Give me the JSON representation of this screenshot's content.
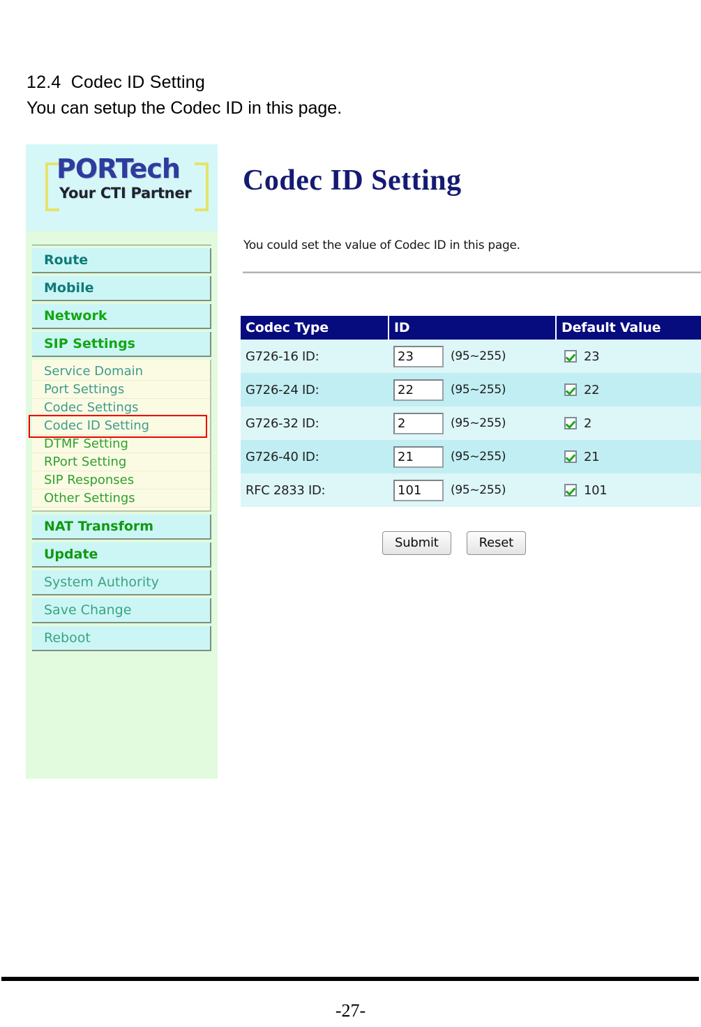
{
  "document": {
    "section_number": "12.4",
    "section_title": "12.4  Codec ID Setting",
    "section_intro": "You can setup the Codec ID in this page.",
    "page_number": "-27-"
  },
  "colors": {
    "header_navy": "#060b7d",
    "title_navy": "#151b72",
    "row_light": "#ddf6f8",
    "row_dark": "#c1eef3",
    "sidebar_green": "#e2fade",
    "logo_cyan": "#d6f7f7",
    "menu_cyan": "#ccf6f6",
    "submenu_cream": "#fbfbe4",
    "highlight_red": "#ee0000",
    "check_green": "#1ea81e"
  },
  "sidebar": {
    "logo": {
      "brand": "PORTech",
      "tagline": "Your CTI Partner"
    },
    "main_items": [
      {
        "label": "Route",
        "style": "teal-bold"
      },
      {
        "label": "Mobile",
        "style": "teal-bold"
      },
      {
        "label": "Network",
        "style": "green-bold"
      },
      {
        "label": "SIP Settings",
        "style": "green-bold"
      }
    ],
    "sip_submenu": [
      {
        "label": "Service Domain",
        "selected": false
      },
      {
        "label": "Port Settings",
        "selected": false
      },
      {
        "label": "Codec Settings",
        "selected": false
      },
      {
        "label": "Codec ID Setting",
        "selected": true
      },
      {
        "label": "DTMF Setting",
        "selected": false
      },
      {
        "label": "RPort Setting",
        "selected": false
      },
      {
        "label": "SIP Responses",
        "selected": false
      },
      {
        "label": "Other Settings",
        "selected": false
      }
    ],
    "bottom_items": [
      {
        "label": "NAT Transform",
        "style": "green-bold"
      },
      {
        "label": "Update",
        "style": "green-bold"
      },
      {
        "label": "System Authority",
        "style": "green-plain"
      },
      {
        "label": "Save Change",
        "style": "green-plain"
      },
      {
        "label": "Reboot",
        "style": "green-plain"
      }
    ]
  },
  "main": {
    "title": "Codec ID Setting",
    "description": "You could set the value of Codec ID in this page.",
    "table": {
      "headers": [
        "Codec Type",
        "ID",
        "Default Value"
      ],
      "rows": [
        {
          "type": "G726-16 ID:",
          "value": "23",
          "range": "(95~255)",
          "default": "23",
          "checked": true
        },
        {
          "type": "G726-24 ID:",
          "value": "22",
          "range": "(95~255)",
          "default": "22",
          "checked": true
        },
        {
          "type": "G726-32 ID:",
          "value": "2",
          "range": "(95~255)",
          "default": "2",
          "checked": true
        },
        {
          "type": "G726-40 ID:",
          "value": "21",
          "range": "(95~255)",
          "default": "21",
          "checked": true
        },
        {
          "type": "RFC 2833 ID:",
          "value": "101",
          "range": "(95~255)",
          "default": "101",
          "checked": true
        }
      ]
    },
    "buttons": {
      "submit": "Submit",
      "reset": "Reset"
    }
  }
}
